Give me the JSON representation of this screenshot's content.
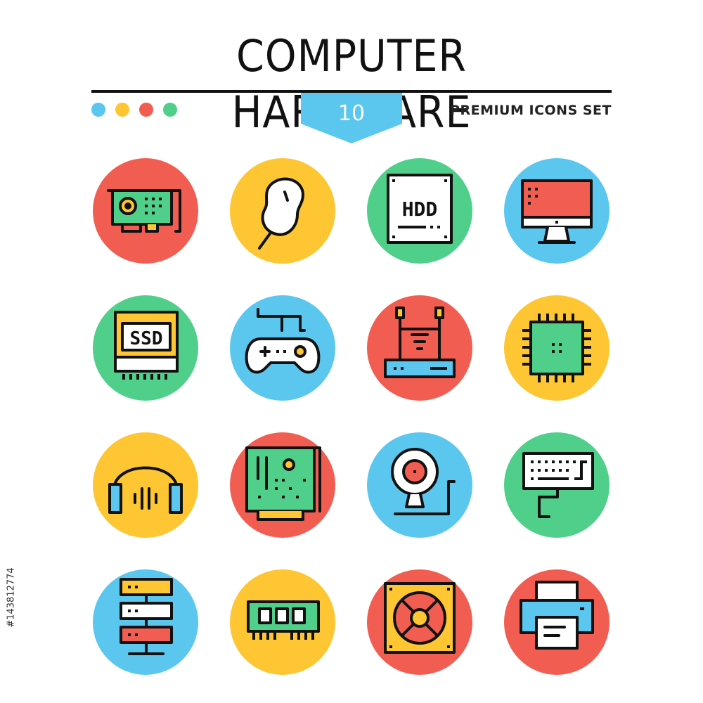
{
  "header": {
    "title": "COMPUTER HARDWARE",
    "badge_number": "10",
    "subtitle": "PREMIUM ICONS SET",
    "dot_colors": [
      "#5bc6ee",
      "#fdc632",
      "#f25d52",
      "#4fcf8a"
    ]
  },
  "palette": {
    "red": "#f25d52",
    "yellow": "#fdc632",
    "green": "#4fcf8a",
    "blue": "#5bc6ee",
    "outline": "#111111"
  },
  "icons": [
    {
      "name": "graphics-card-icon",
      "background": "red"
    },
    {
      "name": "mouse-icon",
      "background": "yellow"
    },
    {
      "name": "hdd-icon",
      "background": "green",
      "label": "HDD"
    },
    {
      "name": "monitor-icon",
      "background": "blue"
    },
    {
      "name": "ssd-icon",
      "background": "green",
      "label": "SSD"
    },
    {
      "name": "gamepad-icon",
      "background": "blue"
    },
    {
      "name": "router-icon",
      "background": "red"
    },
    {
      "name": "cpu-chip-icon",
      "background": "yellow"
    },
    {
      "name": "headphones-icon",
      "background": "yellow"
    },
    {
      "name": "sound-card-icon",
      "background": "red"
    },
    {
      "name": "webcam-icon",
      "background": "blue"
    },
    {
      "name": "keyboard-icon",
      "background": "green"
    },
    {
      "name": "server-rack-icon",
      "background": "blue"
    },
    {
      "name": "ram-memory-icon",
      "background": "yellow"
    },
    {
      "name": "power-supply-fan-icon",
      "background": "red"
    },
    {
      "name": "printer-icon",
      "background": "red"
    }
  ],
  "stock_id": "#143812774"
}
